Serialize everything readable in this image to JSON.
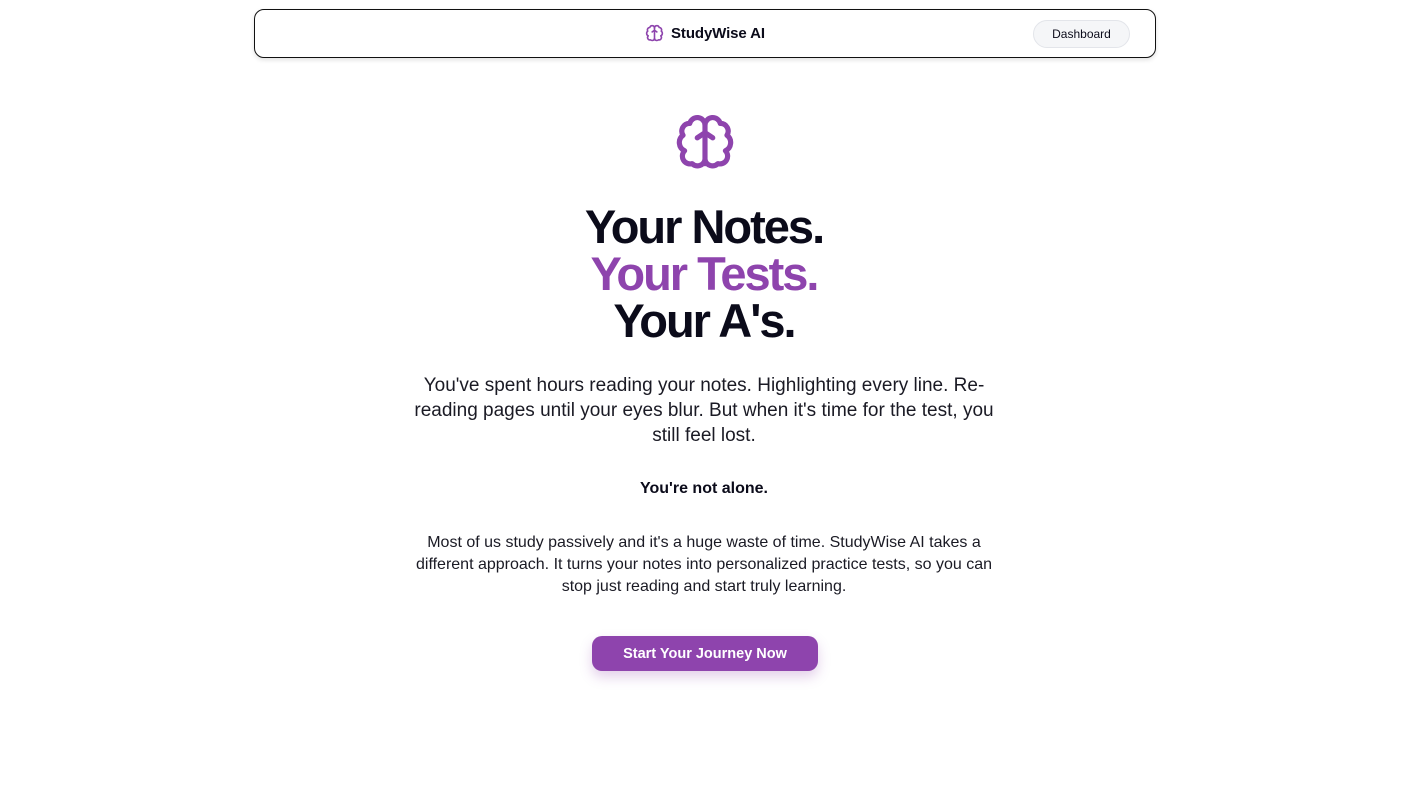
{
  "header": {
    "brand_icon": "brain-icon",
    "brand_name": "StudyWise AI",
    "dashboard_label": "Dashboard"
  },
  "hero": {
    "icon": "brain-icon",
    "headline_line1": "Your Notes.",
    "headline_line2": "Your Tests.",
    "headline_line3": "Your A's.",
    "intro": "You've spent hours reading your notes. Highlighting every line. Re-reading pages until your eyes blur. But when it's time for the test, you still feel lost.",
    "emphasis": "You're not alone.",
    "description": "Most of us study passively and it's a huge waste of time. StudyWise AI takes a different approach. It turns your notes into personalized practice tests, so you can stop just reading and start truly learning.",
    "cta_label": "Start Your Journey Now"
  },
  "colors": {
    "accent": "#8e44ad",
    "text": "#0b0b1a",
    "background": "#ffffff"
  }
}
